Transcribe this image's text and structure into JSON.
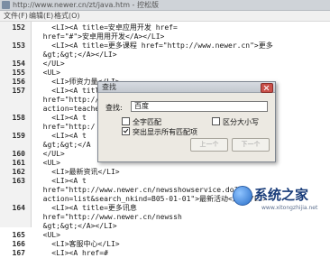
{
  "window": {
    "title": "http://www.newer.cn/zt/java.htm - 控松版"
  },
  "menu": [
    "文件(F)",
    "编辑(E)",
    "格式(O)"
  ],
  "editor": {
    "lines": [
      {
        "num": "152",
        "text": "    <LI><A title=安卓应用开发 href="
      },
      {
        "num": "",
        "text": "  href=\"#\">安卓用用开发</A></LI>"
      },
      {
        "num": "153",
        "text": "    <LI><A title=更多课程 href=\"http://www.newer.cn\">更多"
      },
      {
        "num": "",
        "text": "  &gt;&gt;</A></LI>"
      },
      {
        "num": "154",
        "text": "  </UL>"
      },
      {
        "num": "155",
        "text": "  <UL>"
      },
      {
        "num": "156",
        "text": "    <LI>师资力量</LI>"
      },
      {
        "num": "157",
        "text": "    <LI><A title=牛耳师资"
      },
      {
        "num": "",
        "text": "  href=\"http://www.newer.cn/newsshowservice.do?"
      },
      {
        "num": "",
        "text": "  action=teacher"
      },
      {
        "num": "158",
        "text": "    <LI><A t"
      },
      {
        "num": "",
        "text": "  href=\"http:/"
      },
      {
        "num": "159",
        "text": "    <LI><A t"
      },
      {
        "num": "",
        "text": "  &gt;&gt;</A"
      },
      {
        "num": "160",
        "text": "  </UL>"
      },
      {
        "num": "161",
        "text": "  <UL>"
      },
      {
        "num": "162",
        "text": "    <LI>最新资讯</LI>"
      },
      {
        "num": "163",
        "text": "    <LI><A t"
      },
      {
        "num": "",
        "text": "  href=\"http://www.newer.cn/newsshowservice.do?"
      },
      {
        "num": "",
        "text": "  action=list&search_nkind=B05-01-01\">最新活动</A></LI>"
      },
      {
        "num": "164",
        "text": "    <LI><A title=更多讯息"
      },
      {
        "num": "",
        "text": "  href=\"http://www.newer.cn/newssh"
      },
      {
        "num": "",
        "text": "  &gt;&gt;</A></LI>"
      },
      {
        "num": "165",
        "text": "  <UL>"
      },
      {
        "num": "166",
        "text": "    <LI>客服中心</LI>"
      },
      {
        "num": "167",
        "text": "    <LI><A href=#"
      }
    ]
  },
  "find_dialog": {
    "title": "查找",
    "label": "查找:",
    "query": "百度",
    "options": {
      "whole_word": "全字匹配",
      "match_case": "区分大小写",
      "highlight_all": "突出显示所有匹配项"
    },
    "highlight_all_checked": true,
    "prev_button": "上一个",
    "next_button": "下一个"
  },
  "watermark": {
    "brand": "系统之家",
    "url": "www.xitongzhijia.net"
  }
}
